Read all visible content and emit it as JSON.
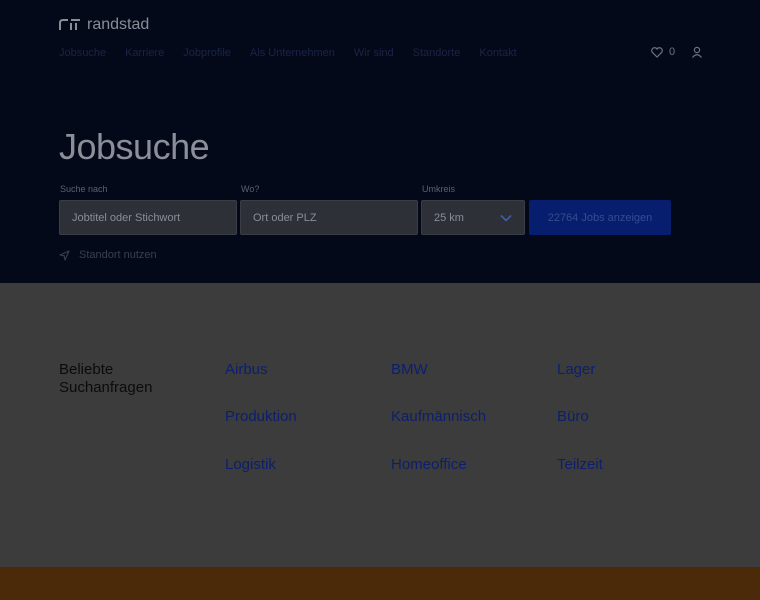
{
  "brand": {
    "name": "randstad"
  },
  "nav": {
    "items": [
      "Jobsuche",
      "Karriere",
      "Jobprofile",
      "Als Unternehmen",
      "Wir sind",
      "Standorte",
      "Kontakt"
    ],
    "favorites_count": "0"
  },
  "hero": {
    "title": "Jobsuche",
    "what_label": "Suche nach",
    "what_placeholder": "Jobtitel oder Stichwort",
    "where_label": "Wo?",
    "where_placeholder": "Ort oder PLZ",
    "radius_label": "Umkreis",
    "radius_value": "25 km",
    "search_button": "22764 Jobs anzeigen",
    "use_location": "Standort nutzen"
  },
  "popular": {
    "heading": "Beliebte Suchanfragen",
    "links": [
      "Airbus",
      "BMW",
      "Lager",
      "Produktion",
      "Kaufmännisch",
      "Büro",
      "Logistik",
      "Homeoffice",
      "Teilzeit"
    ]
  },
  "colors": {
    "hero_bg": "#04091a",
    "accent_blue": "#071e6e",
    "footer_orange": "#4a2a08"
  }
}
